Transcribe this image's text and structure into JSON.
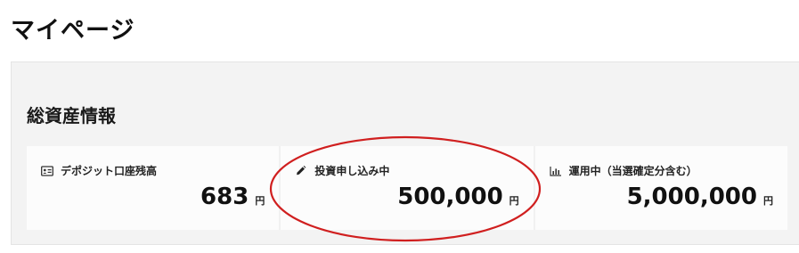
{
  "page": {
    "title": "マイページ"
  },
  "section": {
    "title": "総資産情報"
  },
  "cards": [
    {
      "icon": "id-card-icon",
      "label": "デポジット口座残高",
      "amount": "683",
      "unit": "円"
    },
    {
      "icon": "pencil-icon",
      "label": "投資申し込み中",
      "amount": "500,000",
      "unit": "円"
    },
    {
      "icon": "bar-chart-icon",
      "label": "運用中（当選確定分含む）",
      "amount": "5,000,000",
      "unit": "円"
    }
  ],
  "annotation": {
    "shape": "ellipse",
    "color": "#d01f1f",
    "target": "investment-applying-card"
  }
}
